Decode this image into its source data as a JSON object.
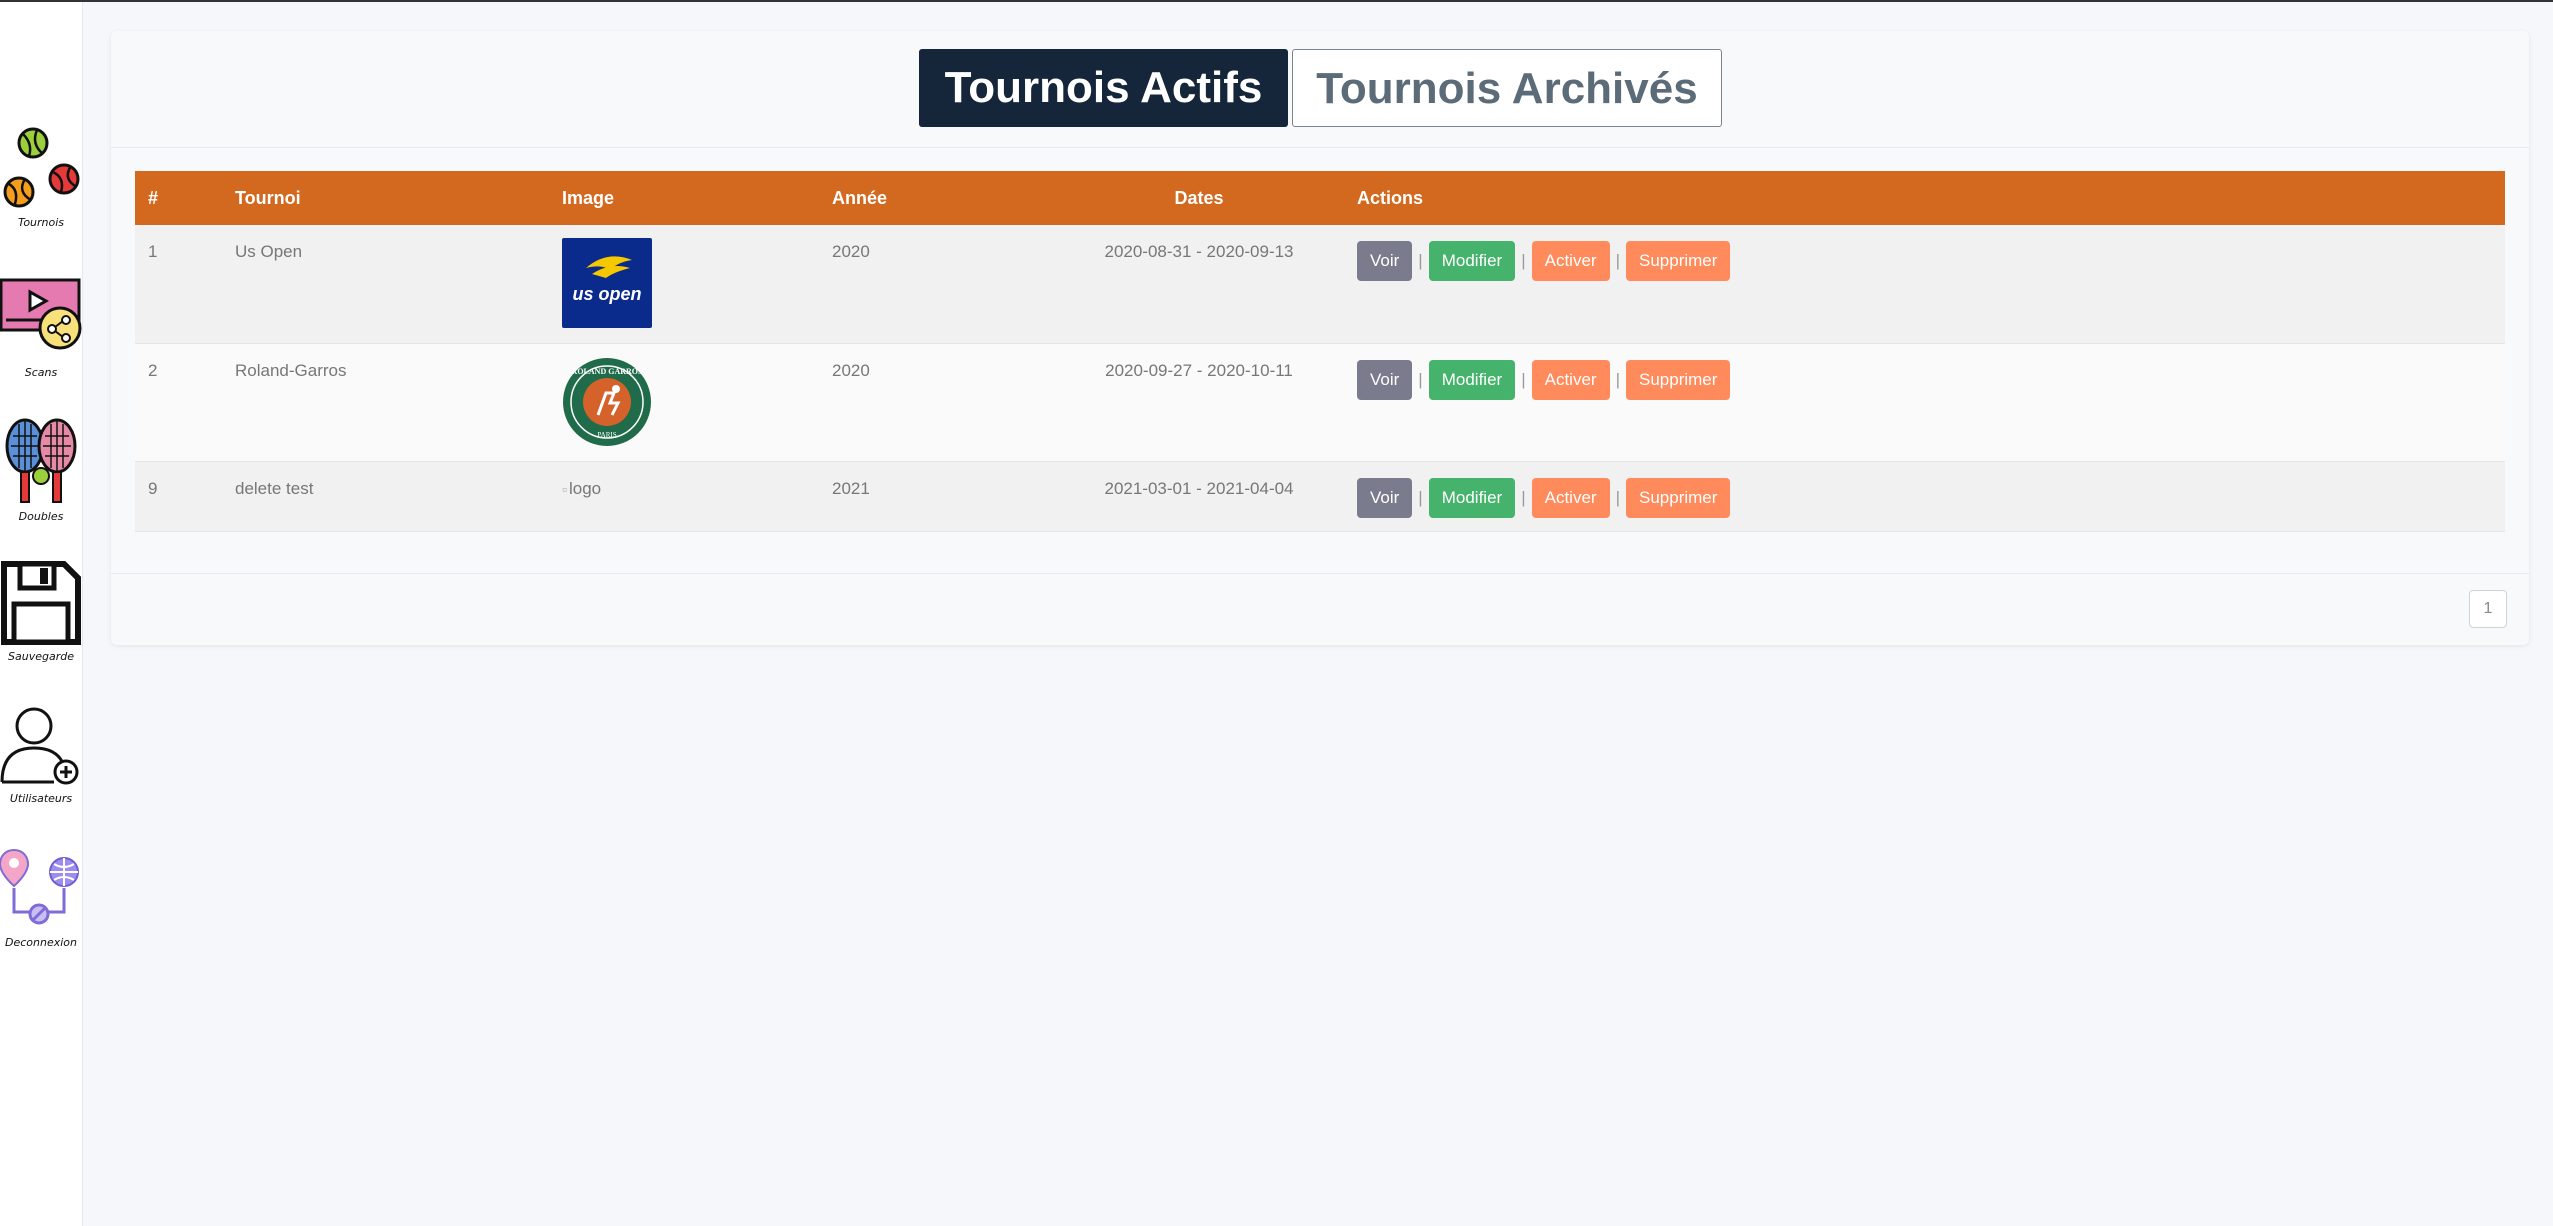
{
  "sidebar": {
    "items": [
      {
        "label": "Tournois",
        "icon": "tennis-balls-icon"
      },
      {
        "label": "Scans",
        "icon": "video-share-icon"
      },
      {
        "label": "Doubles",
        "icon": "tennis-rackets-icon"
      },
      {
        "label": "Sauvegarde",
        "icon": "floppy-disk-icon"
      },
      {
        "label": "Utilisateurs",
        "icon": "add-user-icon"
      },
      {
        "label": "Deconnexion",
        "icon": "location-network-icon"
      }
    ]
  },
  "tabs": {
    "active_label": "Tournois Actifs",
    "archived_label": "Tournois Archivés"
  },
  "table": {
    "headers": {
      "num": "#",
      "tournoi": "Tournoi",
      "image": "Image",
      "annee": "Année",
      "dates": "Dates",
      "actions": "Actions"
    },
    "rows": [
      {
        "num": "1",
        "tournoi": "Us Open",
        "image": "us-open-logo",
        "annee": "2020",
        "dates": "2020-08-31 - 2020-09-13"
      },
      {
        "num": "2",
        "tournoi": "Roland-Garros",
        "image": "roland-garros-logo",
        "annee": "2020",
        "dates": "2020-09-27 - 2020-10-11"
      },
      {
        "num": "9",
        "tournoi": "delete test",
        "image_alt": "logo",
        "annee": "2021",
        "dates": "2021-03-01 - 2021-04-04"
      }
    ],
    "actions": {
      "voir": "Voir",
      "modifier": "Modifier",
      "activer": "Activer",
      "supprimer": "Supprimer",
      "separator": "|"
    }
  },
  "logos": {
    "us_open_text": "us open",
    "rg_text_top": "ROLAND GARROS",
    "rg_text_bottom": "PARIS"
  },
  "pagination": {
    "current": "1"
  },
  "colors": {
    "header_orange": "#d2691e",
    "tab_active": "#15253a",
    "btn_voir": "#7b7b8e",
    "btn_modifier": "#45b36b",
    "btn_activer": "#ff8a5b"
  }
}
